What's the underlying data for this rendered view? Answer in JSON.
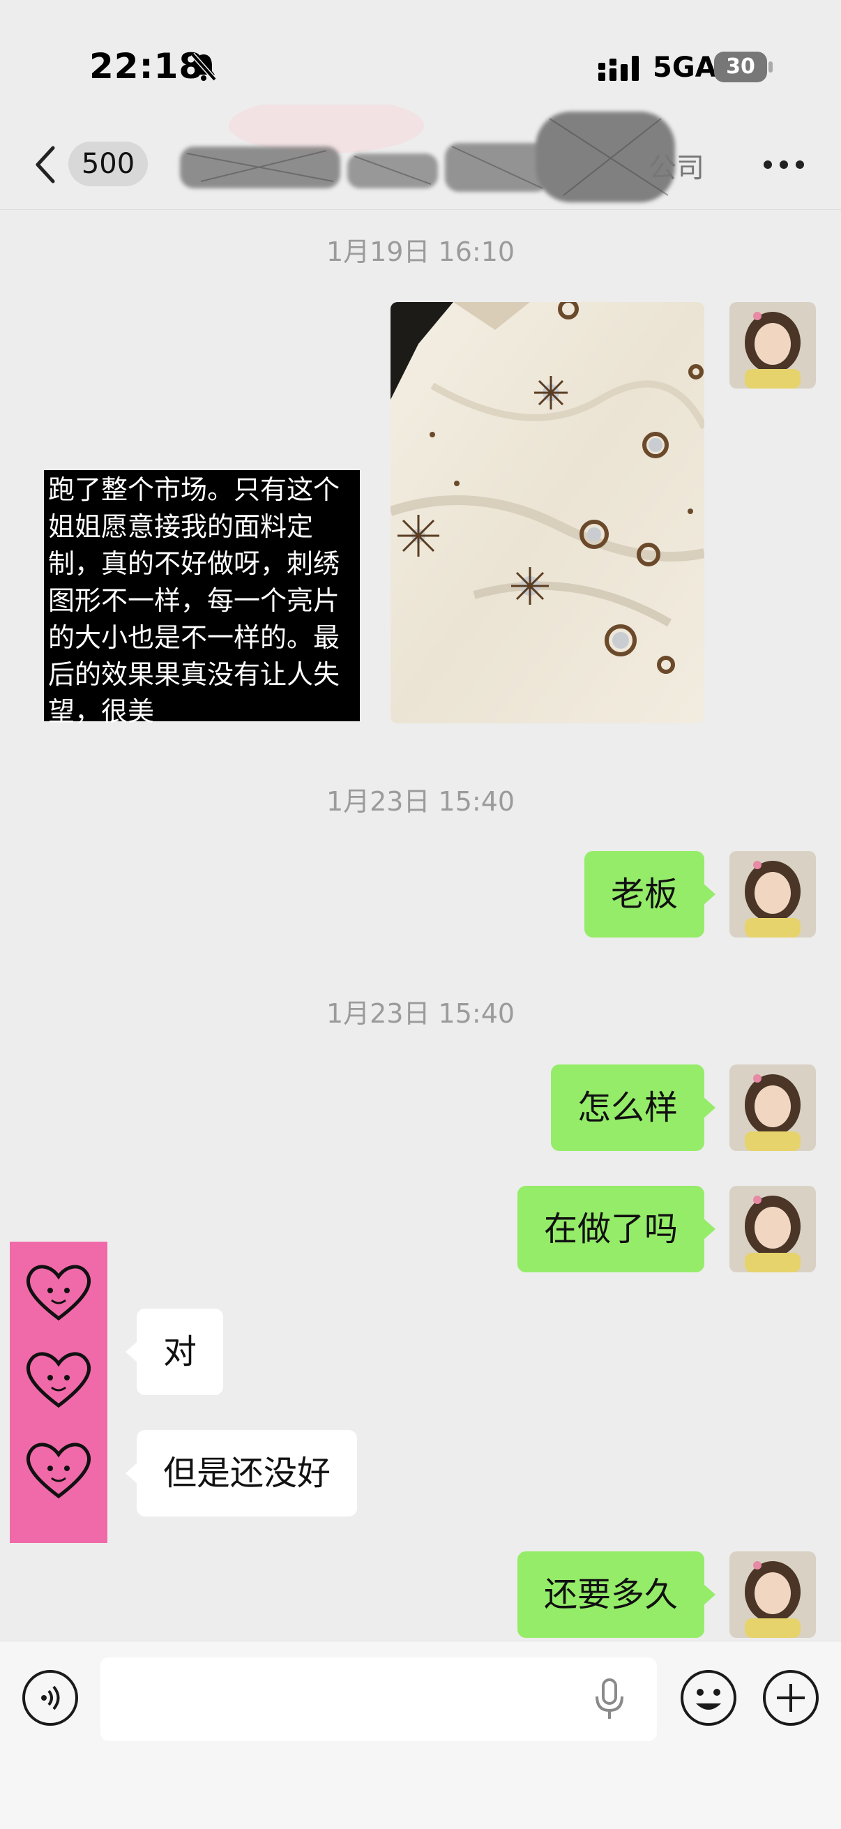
{
  "status_bar": {
    "time": "22:18",
    "network": "5GA",
    "battery": "30"
  },
  "nav": {
    "unread_count": "500",
    "title_visible_fragment": "公司"
  },
  "messages": [
    {
      "type": "timestamp",
      "text": "1月19日 16:10"
    },
    {
      "type": "image",
      "direction": "out",
      "caption": "跑了整个市场。只有这个姐姐愿意接我的面料定制，真的不好做呀，刺绣图形不一样，每一个亮片的大小也是不一样的。最后的效果果真没有让人失望，很美"
    },
    {
      "type": "timestamp",
      "text": "1月23日 15:40"
    },
    {
      "type": "text",
      "direction": "out",
      "text": "老板"
    },
    {
      "type": "timestamp",
      "text": "1月23日 15:40"
    },
    {
      "type": "text",
      "direction": "out",
      "text": "怎么样"
    },
    {
      "type": "text",
      "direction": "out",
      "text": "在做了吗"
    },
    {
      "type": "text",
      "direction": "in",
      "text": "对"
    },
    {
      "type": "text",
      "direction": "in",
      "text": "但是还没好"
    },
    {
      "type": "text",
      "direction": "out",
      "text": "还要多久"
    }
  ],
  "caption_lines": [
    "跑了整个市场。只有这个",
    "姐姐愿意接我的面料定",
    "制，真的不好做呀，刺绣",
    "图形不一样，每一个亮片",
    "的大小也是不一样的。最",
    "后的效果果真没有让人失",
    "望，很美"
  ],
  "colors": {
    "background": "#ededed",
    "outgoing_bubble": "#95ec69",
    "incoming_bubble": "#ffffff",
    "timestamp": "#9b9b9b",
    "sticker_pink": "#f06aa9"
  },
  "icons": [
    "back-icon",
    "mute-bell-icon",
    "signal-icon",
    "more-icon",
    "voice-icon",
    "microphone-icon",
    "emoji-icon",
    "plus-icon",
    "heart-face-icon"
  ]
}
